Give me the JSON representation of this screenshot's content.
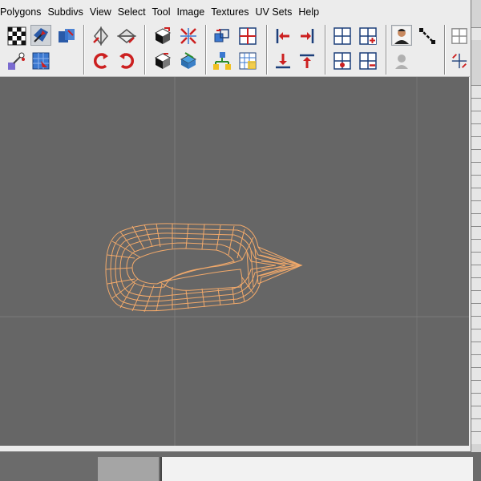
{
  "menu": {
    "items": [
      "Polygons",
      "Subdivs",
      "View",
      "Select",
      "Tool",
      "Image",
      "Textures",
      "UV Sets",
      "Help"
    ]
  },
  "toolbar": {
    "icons": [
      "checker-uv-icon",
      "move-uv-icon",
      "cut-uv-icon",
      "uv-snapshot-icon",
      "grid-uv-icon",
      "flip-u-icon",
      "flip-v-icon",
      "rotate-ccw-icon",
      "rotate-cw-icon",
      "cycle-uv-icon",
      "checker-select-icon",
      "map-borders-icon",
      "separate-icon",
      "align-left-icon",
      "align-right-icon",
      "align-bottom-icon",
      "align-top-icon",
      "move-shell-icon",
      "snap-grid-icon",
      "layout-uv-icon",
      "unfold-uv-icon",
      "grid-pane-icon",
      "add-pane-icon",
      "remove-pane-icon",
      "delete-pane-icon",
      "isolate-select-icon",
      "display-image-icon",
      "user-photo-icon",
      "user-gray-icon",
      "diagonal-line-icon",
      "texture-borders-icon"
    ]
  },
  "colors": {
    "viewport_bg": "#666666",
    "wireframe": "#f2a96a",
    "grid_line": "#7a7a7a",
    "accent_red": "#cc2020",
    "accent_blue": "#2a5aa8"
  }
}
